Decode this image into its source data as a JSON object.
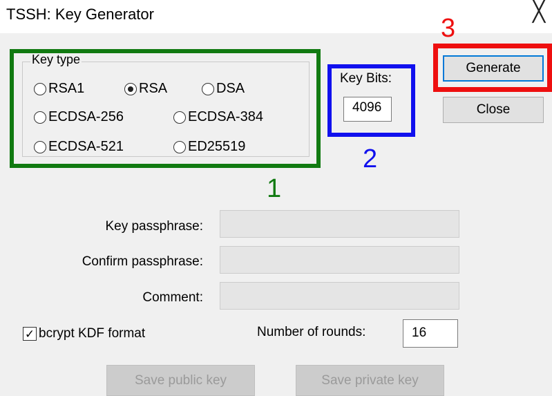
{
  "window": {
    "title": "TSSH: Key Generator",
    "close_glyph": "╳"
  },
  "key_type": {
    "legend": "Key type",
    "options": [
      {
        "label": "RSA1",
        "selected": false
      },
      {
        "label": "RSA",
        "selected": true
      },
      {
        "label": "DSA",
        "selected": false
      },
      {
        "label": "ECDSA-256",
        "selected": false
      },
      {
        "label": "ECDSA-384",
        "selected": false
      },
      {
        "label": "ECDSA-521",
        "selected": false
      },
      {
        "label": "ED25519",
        "selected": false
      }
    ]
  },
  "key_bits": {
    "label": "Key Bits:",
    "value": "4096"
  },
  "buttons": {
    "generate": "Generate",
    "close": "Close",
    "save_public": "Save public key",
    "save_private": "Save private key"
  },
  "fields": {
    "passphrase_label": "Key passphrase:",
    "confirm_label": "Confirm passphrase:",
    "comment_label": "Comment:"
  },
  "bcrypt": {
    "label": "bcrypt KDF format",
    "checked": true,
    "check_glyph": "✓"
  },
  "rounds": {
    "label": "Number of rounds:",
    "value": "16"
  },
  "annotations": {
    "n1": "1",
    "n2": "2",
    "n3": "3",
    "color1": "#117a11",
    "color2": "#1010ee",
    "color3": "#ee0f0f"
  }
}
